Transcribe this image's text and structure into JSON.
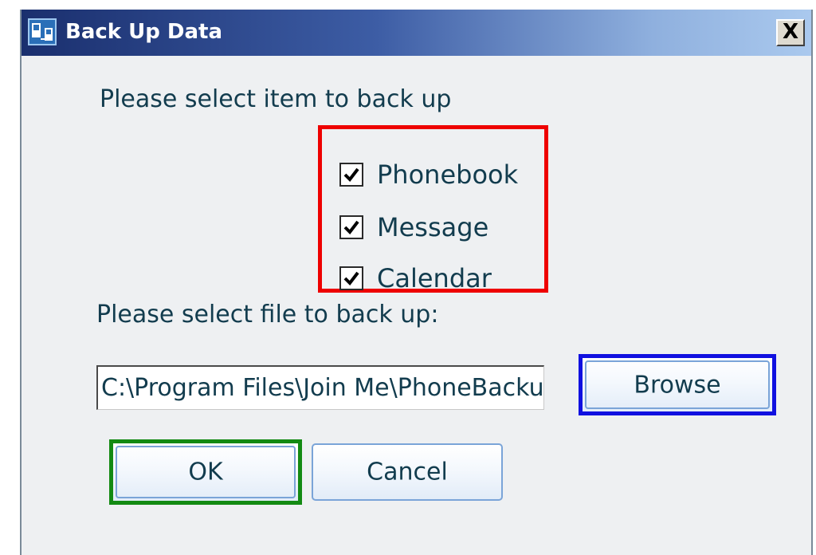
{
  "window": {
    "title": "Back Up Data",
    "close_label": "X",
    "app_icon": "phone-sync-icon"
  },
  "items_section": {
    "prompt": "Please select item to back up",
    "items": [
      {
        "label": "Phonebook",
        "checked": true
      },
      {
        "label": "Message",
        "checked": true
      },
      {
        "label": "Calendar",
        "checked": true
      }
    ]
  },
  "file_section": {
    "prompt": "Please select file to back up:",
    "path_value": "C:\\Program Files\\Join Me\\PhoneBackup",
    "browse_label": "Browse"
  },
  "actions": {
    "ok_label": "OK",
    "cancel_label": "Cancel"
  },
  "colors": {
    "title_gradient_start": "#1a2f6e",
    "title_gradient_end": "#aac9ee",
    "text": "#123c4e",
    "highlight_items": "#ee0000",
    "highlight_browse": "#1010e0",
    "highlight_ok": "#138a13"
  }
}
